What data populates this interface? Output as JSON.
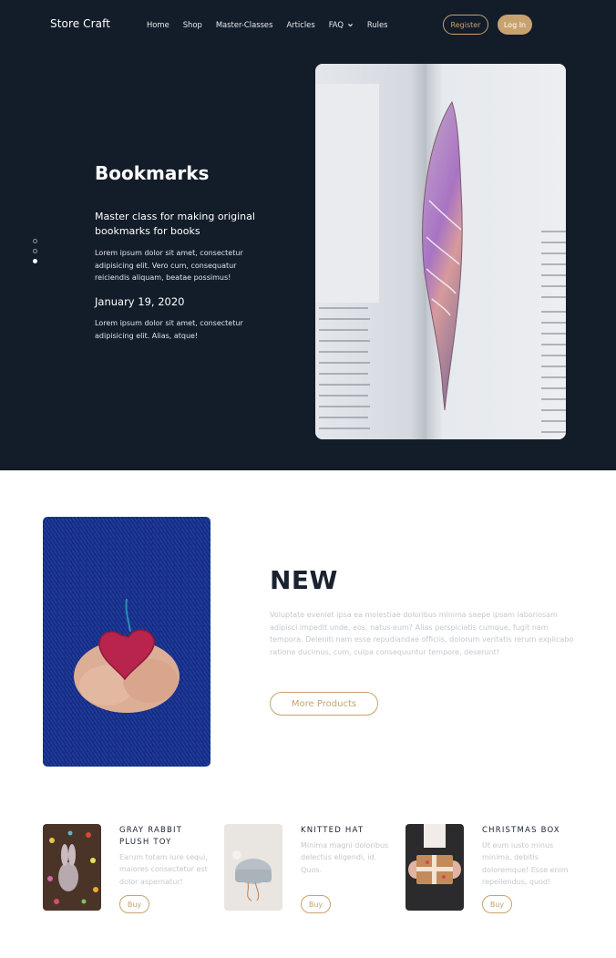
{
  "header": {
    "logo": "Store Craft",
    "nav": [
      "Home",
      "Shop",
      "Master-Classes",
      "Articles",
      "FAQ",
      "Rules"
    ],
    "register": "Register",
    "login": "Log In"
  },
  "hero": {
    "title": "Bookmarks",
    "subtitle": "Master class for making original bookmarks for books",
    "paragraph1": "Lorem ipsum dolor sit amet, consectetur adipisicing elit. Vero cum, consequatur reiciendis aliquam, beatae possimus!",
    "date": "January 19, 2020",
    "paragraph2": "Lorem ipsum dolor sit amet, consectetur adipisicing elit. Alias, atque!",
    "slide_count": 3,
    "active_slide": 3
  },
  "new_section": {
    "title": "NEW",
    "description": "Voluptate eveniet ipsa ea molestiae doloribus minima saepe ipsam laboriosam adipisci impedit unde, eos, natus eum? Alias perspiciatis cumque, fugit nam tempora. Deleniti nam esse repudiandae officiis, dolorum veritatis rerum explicabo ratione ducimus, cum, culpa consequuntur tempore, deserunt!",
    "button": "More Products"
  },
  "products": [
    {
      "name": "GRAY RABBIT PLUSH TOY",
      "description": "Earum totam iure sequi, maiores consectetur est dolor aspernatur!",
      "button": "Buy"
    },
    {
      "name": "KNITTED HAT",
      "description": "Minima magni doloribus delectus eligendi, id. Quos.",
      "button": "Buy"
    },
    {
      "name": "CHRISTMAS BOX",
      "description": "Ut eum iusto minus minima, debitis doloremque! Esse enim repellendus, quod!",
      "button": "Buy"
    }
  ],
  "colors": {
    "hero_bg": "#131c29",
    "accent": "#c8a26e",
    "muted_text": "#c4c8cf"
  }
}
